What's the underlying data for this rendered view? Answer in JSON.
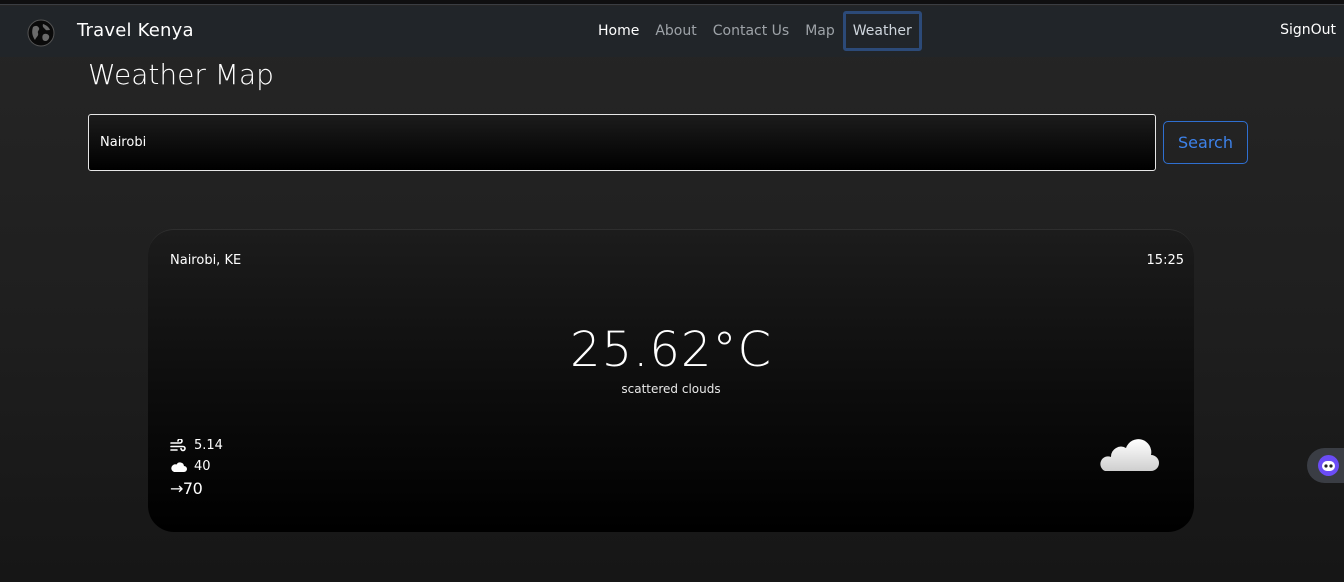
{
  "navbar": {
    "brand": "Travel Kenya",
    "links": [
      {
        "label": "Home"
      },
      {
        "label": "About"
      },
      {
        "label": "Contact Us"
      },
      {
        "label": "Map"
      },
      {
        "label": "Weather"
      }
    ],
    "signout": "SignOut"
  },
  "page": {
    "title": "Weather Map"
  },
  "search": {
    "value": "Nairobi",
    "button_label": "Search"
  },
  "weather": {
    "city": "Nairobi, KE",
    "time": "15:25",
    "temperature": "25.62°C",
    "description": "scattered clouds",
    "wind": "5.14",
    "clouds": "40",
    "direction": "→70",
    "icon": "cloud-icon"
  },
  "icons": {
    "brand": "globe-icon",
    "wind": "wind-icon",
    "clouds": "cloud-small-icon",
    "widget": "assistant-bot-icon"
  },
  "colors": {
    "navbar_bg": "#212529",
    "accent": "#3d82ea",
    "focus_ring": "#2c4a78"
  }
}
